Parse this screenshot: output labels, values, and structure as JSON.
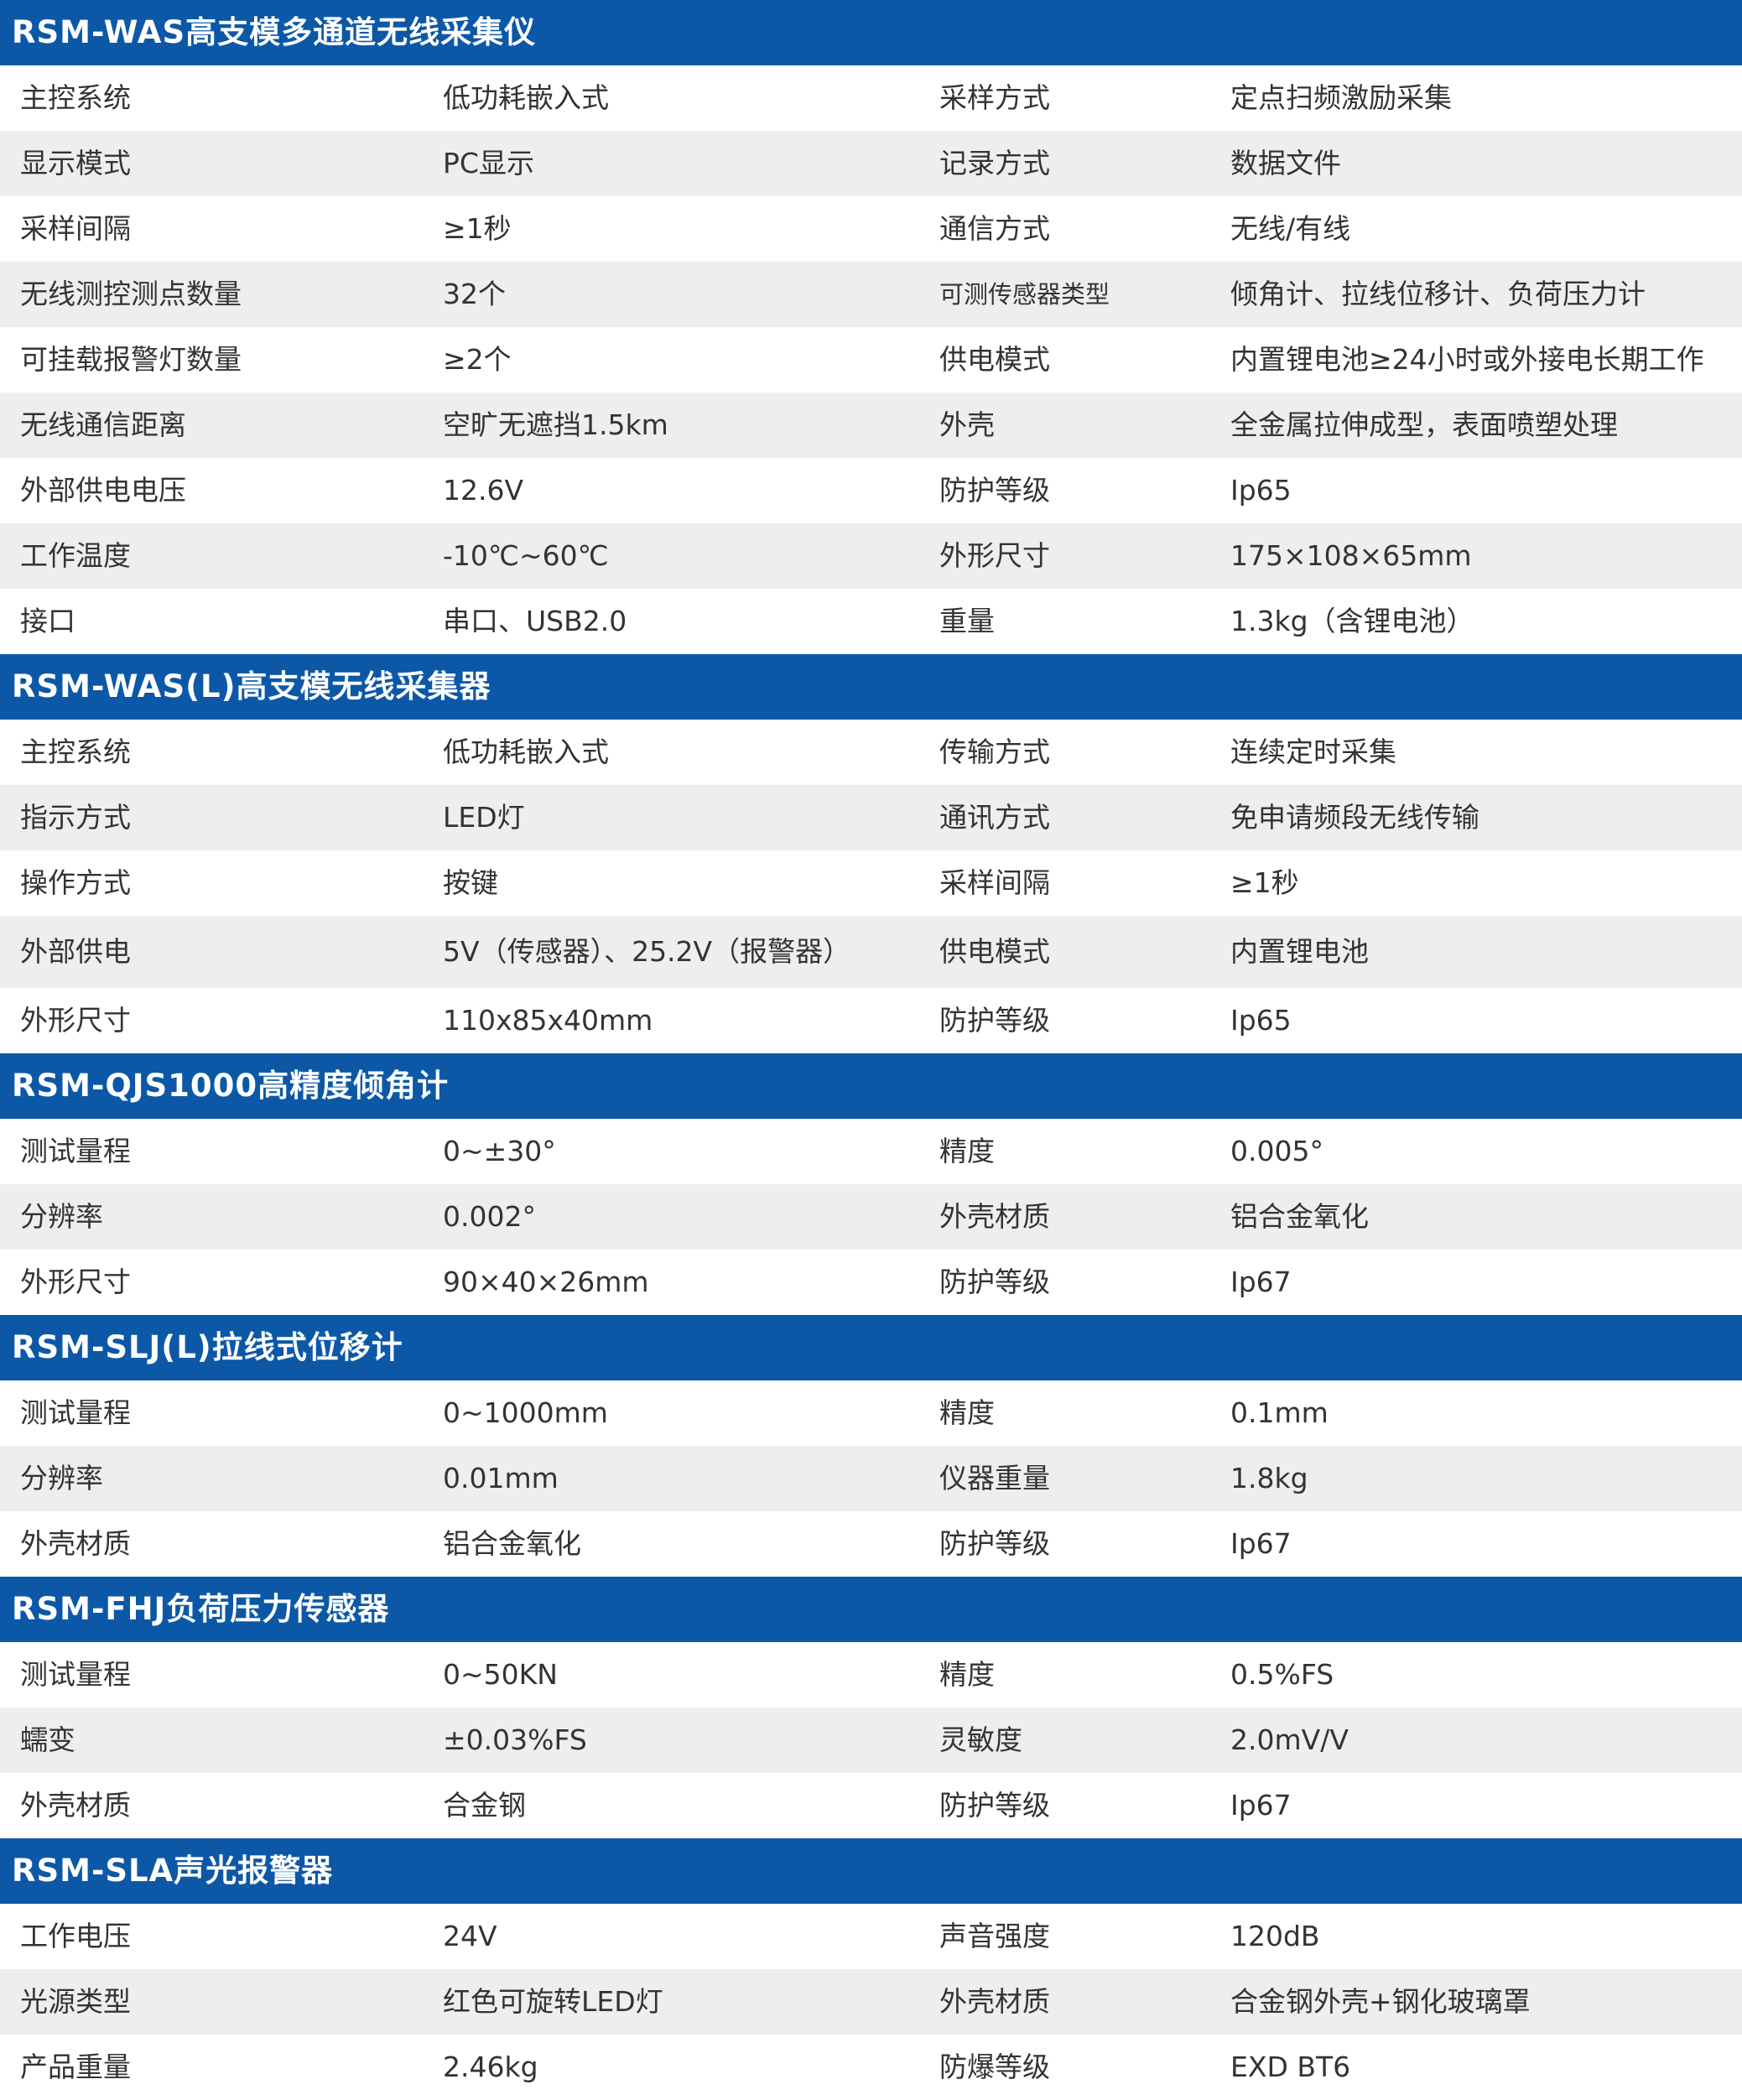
{
  "sections": [
    {
      "title": "RSM-WAS高支模多通道无线采集仪",
      "rows": [
        [
          "主控系统",
          "低功耗嵌入式",
          "采样方式",
          "定点扫频激励采集"
        ],
        [
          "显示模式",
          "PC显示",
          "记录方式",
          "数据文件"
        ],
        [
          "采样间隔",
          "≥1秒",
          "通信方式",
          "无线/有线"
        ],
        [
          "无线测控测点数量",
          "32个",
          "可测传感器类型",
          "倾角计、拉线位移计、负荷压力计"
        ],
        [
          "可挂载报警灯数量",
          "≥2个",
          "供电模式",
          "内置锂电池≥24小时或外接电长期工作"
        ],
        [
          "无线通信距离",
          "空旷无遮挡1.5km",
          "外壳",
          "全金属拉伸成型，表面喷塑处理"
        ],
        [
          "外部供电电压",
          "12.6V",
          "防护等级",
          "Ip65"
        ],
        [
          "工作温度",
          "-10℃~60℃",
          "外形尺寸",
          "175×108×65mm"
        ],
        [
          "接口",
          "串口、USB2.0",
          "重量",
          "1.3kg（含锂电池）"
        ]
      ]
    },
    {
      "title": "RSM-WAS(L)高支模无线采集器",
      "rows": [
        [
          "主控系统",
          "低功耗嵌入式",
          "传输方式",
          "连续定时采集"
        ],
        [
          "指示方式",
          "LED灯",
          "通讯方式",
          "免申请频段无线传输"
        ],
        [
          "操作方式",
          "按键",
          "采样间隔",
          "≥1秒"
        ],
        [
          "外部供电",
          "5V（传感器）、25.2V（报警器）",
          "供电模式",
          "内置锂电池"
        ],
        [
          "外形尺寸",
          "110x85x40mm",
          "防护等级",
          "Ip65"
        ]
      ]
    },
    {
      "title": "RSM-QJS1000高精度倾角计",
      "rows": [
        [
          "测试量程",
          "0~±30°",
          "精度",
          "0.005°"
        ],
        [
          "分辨率",
          "0.002°",
          "外壳材质",
          "铝合金氧化"
        ],
        [
          "外形尺寸",
          "90×40×26mm",
          "防护等级",
          "Ip67"
        ]
      ]
    },
    {
      "title": "RSM-SLJ(L)拉线式位移计",
      "rows": [
        [
          "测试量程",
          "0~1000mm",
          "精度",
          "0.1mm"
        ],
        [
          "分辨率",
          "0.01mm",
          "仪器重量",
          "1.8kg"
        ],
        [
          "外壳材质",
          "铝合金氧化",
          "防护等级",
          "Ip67"
        ]
      ]
    },
    {
      "title": "RSM-FHJ负荷压力传感器",
      "rows": [
        [
          "测试量程",
          "0~50KN",
          "精度",
          "0.5%FS"
        ],
        [
          "蠕变",
          "±0.03%FS",
          "灵敏度",
          "2.0mV/V"
        ],
        [
          "外壳材质",
          "合金钢",
          "防护等级",
          "Ip67"
        ]
      ]
    },
    {
      "title": "RSM-SLA声光报警器",
      "rows": [
        [
          "工作电压",
          "24V",
          "声音强度",
          "120dB"
        ],
        [
          "光源类型",
          "红色可旋转LED灯",
          "外壳材质",
          "合金钢外壳+钢化玻璃罩"
        ],
        [
          "产品重量",
          "2.46kg",
          "防爆等级",
          "EXD BT6"
        ]
      ]
    }
  ]
}
